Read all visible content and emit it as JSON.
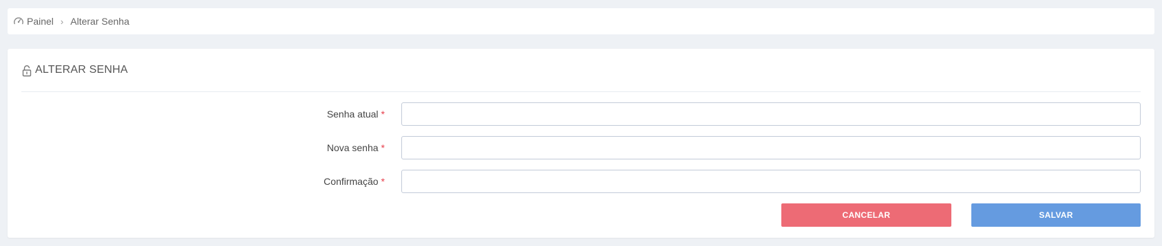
{
  "breadcrumb": {
    "home_label": "Painel",
    "separator": "›",
    "current_label": "Alterar Senha",
    "home_icon": "dashboard-icon"
  },
  "portlet": {
    "title": "ALTERAR SENHA",
    "title_icon": "lock-icon"
  },
  "form": {
    "required_mark": "*",
    "fields": [
      {
        "label": "Senha atual",
        "value": ""
      },
      {
        "label": "Nova senha",
        "value": ""
      },
      {
        "label": "Confirmação",
        "value": ""
      }
    ]
  },
  "actions": {
    "cancel_label": "CANCELAR",
    "save_label": "SALVAR"
  },
  "colors": {
    "page_bg": "#eef1f5",
    "cancel": "#ed6b75",
    "save": "#659be0",
    "required": "#e73d4a"
  }
}
